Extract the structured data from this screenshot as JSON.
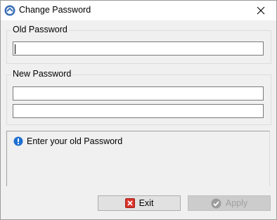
{
  "window": {
    "title": "Change Password"
  },
  "old_password_group": {
    "label": "Old Password",
    "value": ""
  },
  "new_password_group": {
    "label": "New Password",
    "value": "",
    "confirm_value": ""
  },
  "message": {
    "text": "Enter your old Password",
    "icon": "info-icon"
  },
  "buttons": {
    "exit_label": "Exit",
    "apply_label": "Apply",
    "apply_enabled": false
  },
  "colors": {
    "info_icon": "#1f6fd1",
    "exit_icon": "#d9342b",
    "app_icon": "#3b6fb6"
  }
}
